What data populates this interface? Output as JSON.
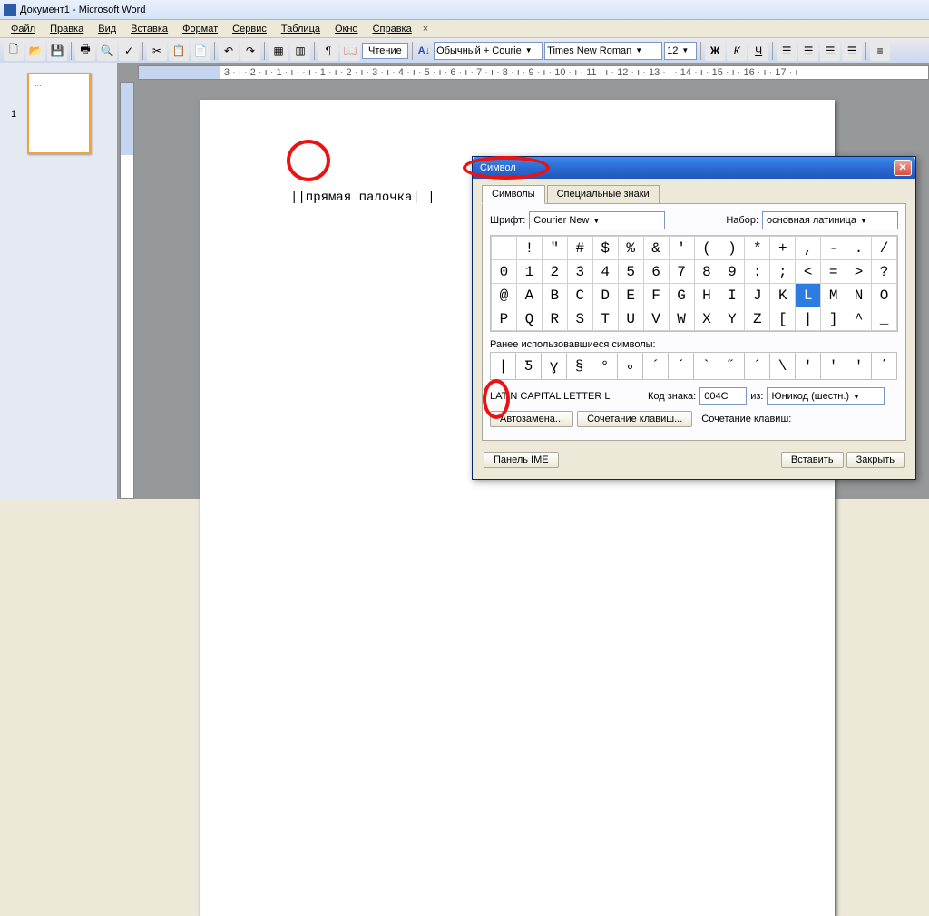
{
  "app": {
    "title": "Документ1 - Microsoft Word"
  },
  "menu": [
    "Файл",
    "Правка",
    "Вид",
    "Вставка",
    "Формат",
    "Сервис",
    "Таблица",
    "Окно",
    "Справка"
  ],
  "toolbar": {
    "reading": "Чтение",
    "style": "Обычный + Courie",
    "font": "Times New Roman",
    "size": "12",
    "bold": "Ж",
    "italic": "К",
    "under": "Ч"
  },
  "thumb": {
    "page": "1"
  },
  "doc": {
    "text": "||прямая палочка| |"
  },
  "ruler": "3 · ı · 2 · ı · 1 · ı ·   · ı · 1 · ı · 2 · ı · 3 · ı · 4 · ı · 5 · ı · 6 · ı · 7 · ı · 8 · ı · 9 · ı · 10 · ı · 11 · ı · 12 · ı · 13 · ı · 14 · ı · 15 · ı · 16 · ı · 17 · ı",
  "dlg": {
    "title": "Символ",
    "tab1": "Символы",
    "tab2": "Специальные знаки",
    "font_label": "Шрифт:",
    "font": "Courier New",
    "set_label": "Набор:",
    "set": "основная латиница",
    "recent_label": "Ранее использовавшиеся символы:",
    "charname": "LATIN CAPITAL LETTER L",
    "code_label": "Код знака:",
    "code": "004C",
    "from_label": "из:",
    "from": "Юникод (шестн.)",
    "autocorrect": "Автозамена...",
    "shortcut_btn": "Сочетание клавиш...",
    "shortcut_label": "Сочетание клавиш:",
    "ime": "Панель IME",
    "insert": "Вставить",
    "close": "Закрыть",
    "grid": [
      [
        " ",
        "!",
        "\"",
        "#",
        "$",
        "%",
        "&",
        "'",
        "(",
        ")",
        "*",
        "+",
        ",",
        "-",
        ".",
        "/"
      ],
      [
        "0",
        "1",
        "2",
        "3",
        "4",
        "5",
        "6",
        "7",
        "8",
        "9",
        ":",
        ";",
        "<",
        "=",
        ">",
        "?"
      ],
      [
        "@",
        "A",
        "B",
        "C",
        "D",
        "E",
        "F",
        "G",
        "H",
        "I",
        "J",
        "K",
        "L",
        "M",
        "N",
        "O"
      ],
      [
        "P",
        "Q",
        "R",
        "S",
        "T",
        "U",
        "V",
        "W",
        "X",
        "Y",
        "Z",
        "[",
        "|",
        "]",
        "^",
        "_"
      ]
    ],
    "selected": "L",
    "recent": [
      "|",
      "Ƽ",
      "ɣ",
      "§",
      "°",
      "∘",
      "´",
      "´",
      "`",
      "˝",
      "´",
      "\\",
      "ʹ",
      "′",
      "ʹ",
      "΄"
    ]
  }
}
